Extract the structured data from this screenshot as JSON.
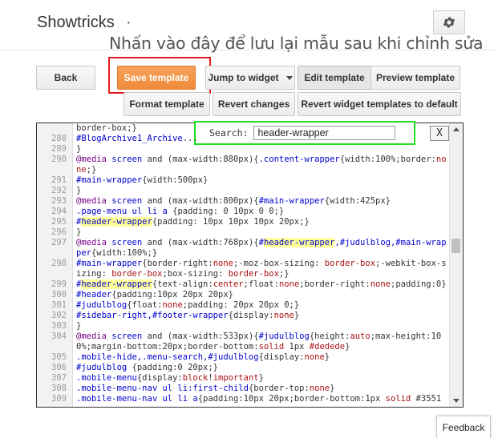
{
  "header": {
    "title": "Showtricks",
    "dot": "·",
    "settings_icon": "gear-icon"
  },
  "annotation": "Nhấn vào đây để lưu lại mẫu sau khi chỉnh sửa",
  "toolbar": {
    "back": "Back",
    "save_template": "Save template",
    "jump_to_widget": "Jump to widget",
    "edit_template": "Edit template",
    "preview_template": "Preview template",
    "format_template": "Format template",
    "revert_changes": "Revert changes",
    "revert_widget_templates": "Revert widget templates to default"
  },
  "search": {
    "label": "Search:",
    "value": "header-wrapper",
    "close": "X"
  },
  "feedback": "Feedback",
  "colors": {
    "save_button": "#f08a3a",
    "highlight_box": "#e8191b",
    "search_box_border": "#22dd22",
    "match_highlight": "#ffff99"
  },
  "code_lines": [
    {
      "n": "",
      "segs": [
        [
          "p",
          "border-box;}"
        ]
      ]
    },
    {
      "n": "288",
      "segs": [
        [
          "s",
          "#BlogArchive1_Archive"
        ],
        [
          "p",
          "..."
        ]
      ]
    },
    {
      "n": "289",
      "segs": [
        [
          "p",
          "}"
        ]
      ]
    },
    {
      "n": "290",
      "segs": [
        [
          "k",
          "@media"
        ],
        [
          "p",
          " "
        ],
        [
          "s",
          "screen"
        ],
        [
          "p",
          " and (max-width:880px){"
        ],
        [
          "s",
          ".content-wrapper"
        ],
        [
          "p",
          "{width:100%;border:"
        ],
        [
          "v",
          "none"
        ],
        [
          "p",
          ";}"
        ]
      ]
    },
    {
      "n": "291",
      "segs": [
        [
          "s",
          "#main-wrapper"
        ],
        [
          "p",
          "{width:500px}"
        ]
      ]
    },
    {
      "n": "292",
      "segs": [
        [
          "p",
          "}"
        ]
      ]
    },
    {
      "n": "293",
      "segs": [
        [
          "k",
          "@media"
        ],
        [
          "p",
          " "
        ],
        [
          "s",
          "screen"
        ],
        [
          "p",
          " and (max-width:800px){"
        ],
        [
          "s",
          "#main-wrapper"
        ],
        [
          "p",
          "{width:425px}"
        ]
      ]
    },
    {
      "n": "294",
      "segs": [
        [
          "s",
          ".page-menu ul li a"
        ],
        [
          "p",
          " {padding: 0 10px 0 0;}"
        ]
      ]
    },
    {
      "n": "295",
      "segs": [
        [
          "s",
          "#"
        ],
        [
          "h",
          "header-wrapper"
        ],
        [
          "p",
          "{padding: 10px 10px 10px 20px;}"
        ]
      ]
    },
    {
      "n": "296",
      "segs": [
        [
          "p",
          "}"
        ]
      ]
    },
    {
      "n": "297",
      "segs": [
        [
          "k",
          "@media"
        ],
        [
          "p",
          " "
        ],
        [
          "s",
          "screen"
        ],
        [
          "p",
          " and (max-width:768px){"
        ],
        [
          "s",
          "#"
        ],
        [
          "h",
          "header-wrapper"
        ],
        [
          "s",
          ",#judulblog,#main-wrapper"
        ],
        [
          "p",
          "{width:100%;}"
        ]
      ]
    },
    {
      "n": "298",
      "segs": [
        [
          "s",
          "#main-wrapper"
        ],
        [
          "p",
          "{border-right:"
        ],
        [
          "v",
          "none"
        ],
        [
          "p",
          ";-moz-box-sizing: "
        ],
        [
          "v",
          "border-box"
        ],
        [
          "p",
          ";-webkit-box-sizing: "
        ],
        [
          "v",
          "border-box"
        ],
        [
          "p",
          ";box-sizing: "
        ],
        [
          "v",
          "border-box"
        ],
        [
          "p",
          ";}"
        ]
      ]
    },
    {
      "n": "299",
      "segs": [
        [
          "s",
          "#"
        ],
        [
          "h",
          "header-wrapper"
        ],
        [
          "p",
          "{text-align:"
        ],
        [
          "v",
          "center"
        ],
        [
          "p",
          ";float:"
        ],
        [
          "v",
          "none"
        ],
        [
          "p",
          ";border-right:"
        ],
        [
          "v",
          "none"
        ],
        [
          "p",
          ";padding:0}"
        ]
      ]
    },
    {
      "n": "300",
      "segs": [
        [
          "s",
          "#header"
        ],
        [
          "p",
          "{padding:10px 20px 20px}"
        ]
      ]
    },
    {
      "n": "301",
      "segs": [
        [
          "s",
          "#judulblog"
        ],
        [
          "p",
          "{float:"
        ],
        [
          "v",
          "none"
        ],
        [
          "p",
          ";padding: 20px 20px 0;}"
        ]
      ]
    },
    {
      "n": "302",
      "segs": [
        [
          "s",
          "#sidebar-right,#footer-wrapper"
        ],
        [
          "p",
          "{display:"
        ],
        [
          "v",
          "none"
        ],
        [
          "p",
          "}"
        ]
      ]
    },
    {
      "n": "303",
      "segs": [
        [
          "p",
          "}"
        ]
      ]
    },
    {
      "n": "304",
      "segs": [
        [
          "k",
          "@media"
        ],
        [
          "p",
          " "
        ],
        [
          "s",
          "screen"
        ],
        [
          "p",
          " and (max-width:533px){"
        ],
        [
          "s",
          "#judulblog"
        ],
        [
          "p",
          "{height:"
        ],
        [
          "v",
          "auto"
        ],
        [
          "p",
          ";max-height:100%;margin-bottom:20px;border-bottom:"
        ],
        [
          "v",
          "solid"
        ],
        [
          "p",
          " 1px "
        ],
        [
          "v",
          "#dedede"
        ],
        [
          "p",
          "}"
        ]
      ]
    },
    {
      "n": "305",
      "segs": [
        [
          "s",
          ".mobile-hide,.menu-search,#judulblog"
        ],
        [
          "p",
          "{display:"
        ],
        [
          "v",
          "none"
        ],
        [
          "p",
          "}"
        ]
      ]
    },
    {
      "n": "306",
      "segs": [
        [
          "s",
          "#judulblog"
        ],
        [
          "p",
          " {padding:0 20px;}"
        ]
      ]
    },
    {
      "n": "307",
      "segs": [
        [
          "s",
          ".mobile-menu"
        ],
        [
          "p",
          "{display:"
        ],
        [
          "v",
          "block"
        ],
        [
          "p",
          "!"
        ],
        [
          "v",
          "important"
        ],
        [
          "p",
          "}"
        ]
      ]
    },
    {
      "n": "308",
      "segs": [
        [
          "s",
          ".mobile-menu-nav ul li:first-child"
        ],
        [
          "p",
          "{border-top:"
        ],
        [
          "v",
          "none"
        ],
        [
          "p",
          "}"
        ]
      ]
    },
    {
      "n": "309",
      "segs": [
        [
          "s",
          ".mobile-menu-nav ul li a"
        ],
        [
          "p",
          "{padding:10px 20px;border-bottom:1px "
        ],
        [
          "v",
          "solid"
        ],
        [
          "p",
          " #3551"
        ]
      ]
    }
  ]
}
